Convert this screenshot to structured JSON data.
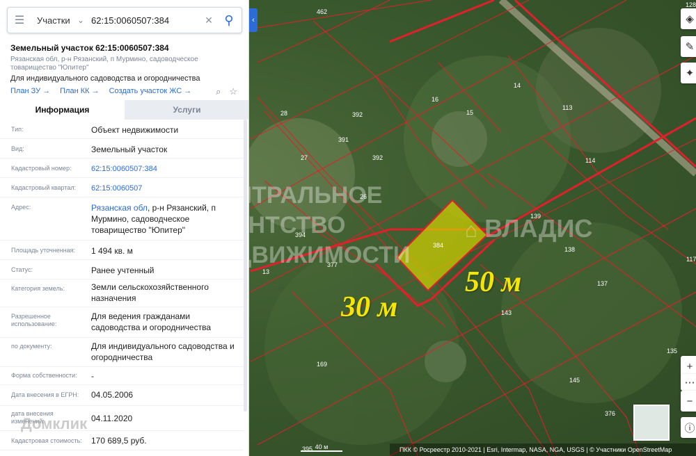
{
  "search": {
    "type_label": "Участки",
    "query": "62:15:0060507:384"
  },
  "parcel": {
    "title": "Земельный участок 62:15:0060507:384",
    "address": "Рязанская обл, р-н Рязанский, п Мурмино, садоводческое товарищество \"Юпитер\"",
    "purpose": "Для индивидуального садоводства и огородничества",
    "links": [
      "План ЗУ →",
      "План КК →",
      "Создать участок ЖС →"
    ]
  },
  "tabs": [
    "Информация",
    "Услуги"
  ],
  "properties": [
    {
      "label": "Тип:",
      "value": "Объект недвижимости"
    },
    {
      "label": "Вид:",
      "value": "Земельный участок"
    },
    {
      "label": "Кадастровый номер:",
      "value": "62:15:0060507:384",
      "link": true
    },
    {
      "label": "Кадастровый квартал:",
      "value": "62:15:0060507",
      "link": true
    },
    {
      "label": "Адрес:",
      "value_link": "Рязанская обл",
      "value": ", р-н Рязанский, п Мурмино, садоводческое товарищество \"Юпитер\""
    },
    {
      "label": "Площадь уточненная:",
      "value": "1 494 кв. м"
    },
    {
      "label": "Статус:",
      "value": "Ранее учтенный"
    },
    {
      "label": "Категория земель:",
      "value": "Земли сельскохозяйственного назначения"
    },
    {
      "label": "Разрешенное использование:",
      "value": "Для ведения гражданами садоводства и огородничества"
    },
    {
      "label": "по документу:",
      "value": "Для индивидуального садоводства и огородничества"
    },
    {
      "label": "Форма собственности:",
      "value": "-"
    },
    {
      "label": "Дата внесения в ЕГРН:",
      "value": "04.05.2006"
    },
    {
      "label": "дата внесения изменений:",
      "value": "04.11.2020"
    },
    {
      "label": "Кадастровая стоимость:",
      "value": "170 689,5 руб."
    }
  ],
  "map": {
    "parcel_numbers": [
      "462",
      "128",
      "392",
      "16",
      "15",
      "14",
      "113",
      "28",
      "391",
      "27",
      "392",
      "26",
      "384",
      "139",
      "114",
      "394",
      "377",
      "13",
      "138",
      "137",
      "143",
      "169",
      "135",
      "145",
      "376",
      "117",
      "395"
    ],
    "measure_30": "30 м",
    "measure_50": "50 м",
    "watermark_1": "ЦЕНТРАЛЬНОЕ",
    "watermark_2": "АГЕНТСТВО",
    "watermark_3": "НЕДВИЖИМОСТИ",
    "watermark_brand": "ВЛАДИС",
    "domclick": "Домклик",
    "scale_label": "40 м",
    "attribution": "ПКК © Росреестр 2010-2021 | Esri, Intermap, NASA, NGA, USGS | © Участники OpenStreetMap",
    "colors": {
      "boundary": "#e0202a",
      "selected_fill": "#d4d400",
      "measure": "#f5e600",
      "accent": "#2b6cd8"
    }
  }
}
